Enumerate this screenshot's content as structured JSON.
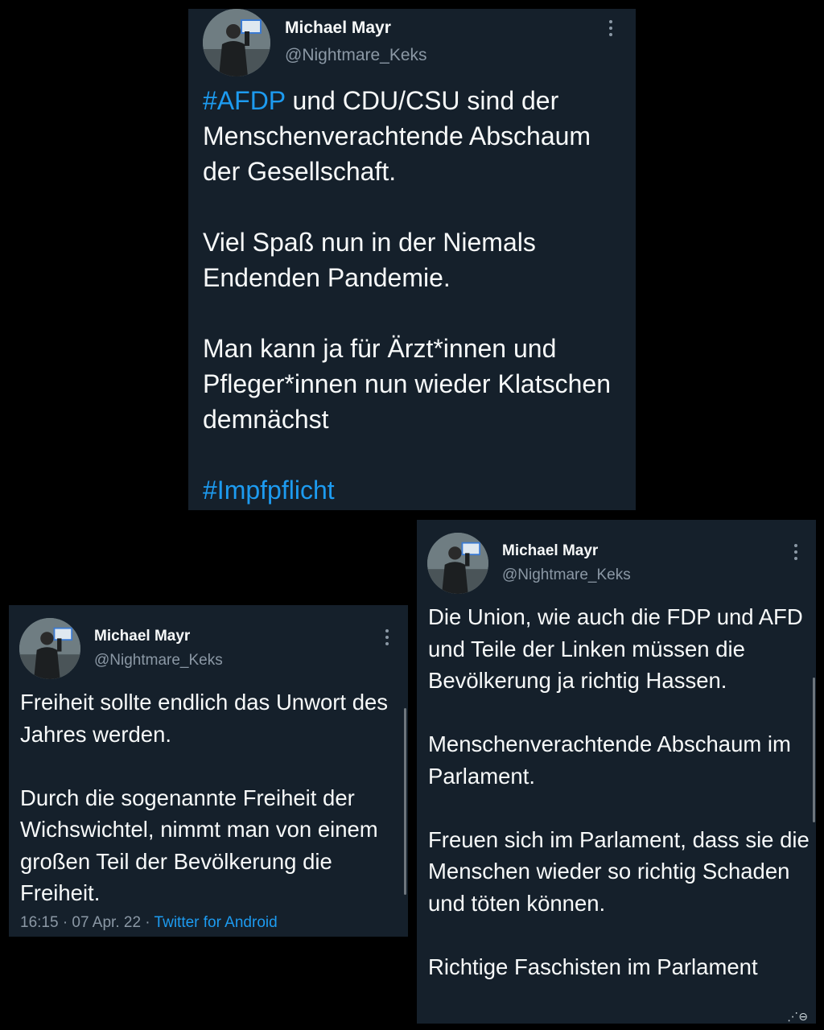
{
  "tweet1": {
    "author_name": "Michael Mayr",
    "handle": "@Nightmare_Keks",
    "p1_hashtag": "#AFDP",
    "p1_rest": " und CDU/CSU sind der Menschenverachtende Abschaum der Gesellschaft.",
    "p2": "Viel Spaß nun in der Niemals Endenden Pandemie.",
    "p3": "Man kann ja für Ärzt*innen und Pfleger*innen nun wieder Klatschen demnächst",
    "p4_hashtag": "#Impfpflicht"
  },
  "tweet2": {
    "author_name": "Michael Mayr",
    "handle": "@Nightmare_Keks",
    "p1": "Freiheit sollte endlich das Unwort des Jahres werden.",
    "p2": "Durch die sogenannte Freiheit der Wichswichtel, nimmt man von einem großen Teil der Bevölkerung die Freiheit.",
    "timestamp": "16:15 · 07 Apr. 22 · ",
    "source": "Twitter for Android"
  },
  "tweet3": {
    "author_name": "Michael Mayr",
    "handle": "@Nightmare_Keks",
    "p1": "Die Union, wie auch die FDP und AFD und Teile der Linken müssen die Bevölkerung ja richtig Hassen.",
    "p2": "Menschenverachtende Abschaum im Parlament.",
    "p3": "Freuen sich im Parlament, dass sie die Menschen wieder so richtig Schaden und töten können.",
    "p4": "Richtige Faschisten im Parlament"
  },
  "icons": {
    "more": "more-vertical-icon",
    "corner": "watermark-icon"
  },
  "colors": {
    "background": "#000000",
    "card": "#15202b",
    "text": "#f7f9f9",
    "secondary": "#8b98a5",
    "accent": "#1d9bf0"
  }
}
